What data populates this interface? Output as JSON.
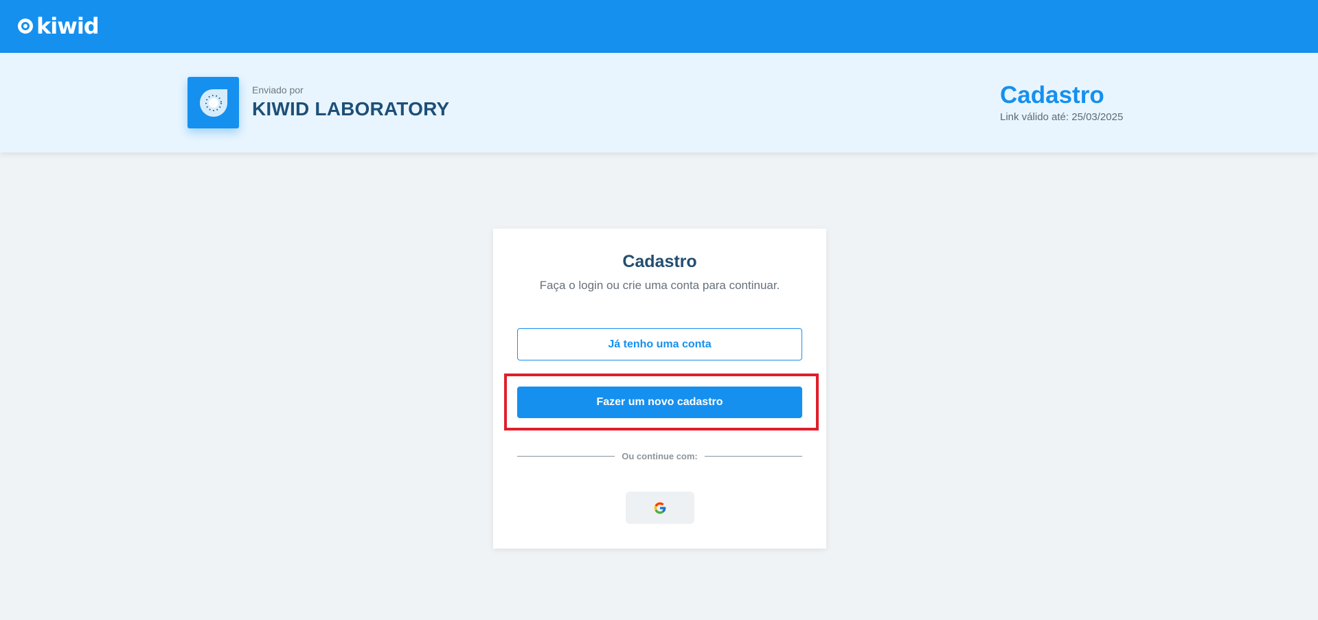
{
  "topbar": {
    "brand_name": "kiwid",
    "brand_color": "#1590ef"
  },
  "header": {
    "sent_by_label": "Enviado por",
    "organization_name": "KIWID LABORATORY",
    "title": "Cadastro",
    "link_valid": "Link válido até: 25/03/2025"
  },
  "card": {
    "title": "Cadastro",
    "subtitle": "Faça o login ou crie uma conta para continuar.",
    "existing_account_label": "Já tenho uma conta",
    "new_account_label": "Fazer um novo cadastro",
    "divider_text": "Ou continue com:",
    "google_icon": "google-icon"
  },
  "colors": {
    "accent": "#1590ef",
    "header_bg": "#e9f5fe",
    "page_bg": "#eff3f5",
    "highlight": "#e11d2a",
    "title_dark": "#1d4f78"
  }
}
